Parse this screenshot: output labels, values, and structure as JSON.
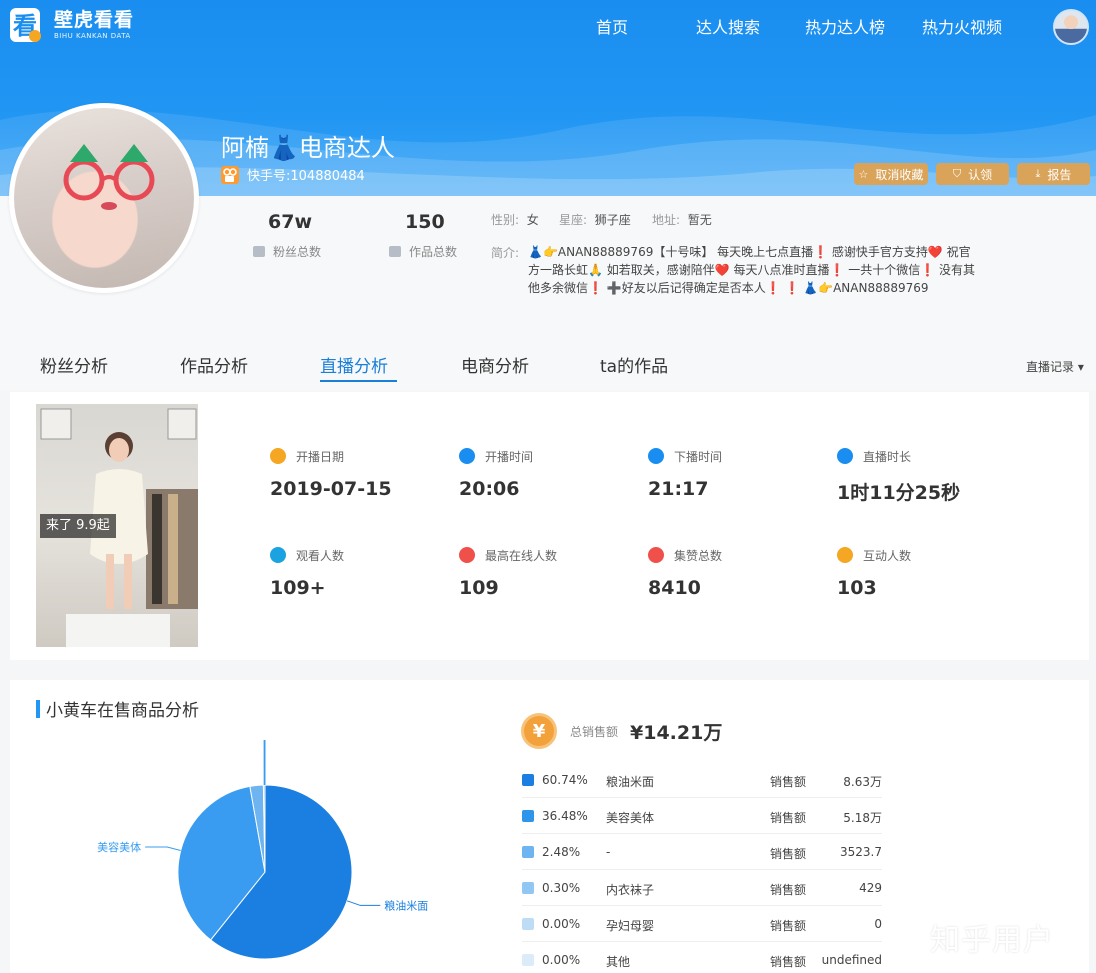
{
  "brand": {
    "title": "壁虎看看",
    "subtitle": "BIHU KANKAN DATA"
  },
  "nav": [
    {
      "label": "首页"
    },
    {
      "label": "达人搜索"
    },
    {
      "label": "热力达人榜"
    },
    {
      "label": "热力火视频"
    }
  ],
  "profile": {
    "name": "阿楠👗电商达人",
    "kuaishou_id": "快手号:104880484",
    "actions": {
      "unfollow": "取消收藏",
      "claim": "认领",
      "report": "报告"
    },
    "fans": {
      "value": "67w",
      "label": "粉丝总数"
    },
    "works": {
      "value": "150",
      "label": "作品总数"
    },
    "gender": {
      "label": "性别:",
      "value": "女"
    },
    "zodiac": {
      "label": "星座:",
      "value": "狮子座"
    },
    "location": {
      "label": "地址:",
      "value": "暂无"
    },
    "bio_label": "简介:",
    "bio": "👗👉ANAN88889769【十号味】 每天晚上七点直播❗ 感谢快手官方支持❤️ 祝官方一路长虹🙏 如若取关，感谢陪伴❤️ 每天八点准时直播❗ 一共十个微信❗ 没有其他多余微信❗ ➕好友以后记得确定是否本人❗ ❗ 👗👉ANAN88889769"
  },
  "tabs": [
    {
      "label": "粉丝分析"
    },
    {
      "label": "作品分析"
    },
    {
      "label": "直播分析",
      "active": true
    },
    {
      "label": "电商分析"
    },
    {
      "label": "ta的作品"
    }
  ],
  "live_record_dropdown": "直播记录 ▾",
  "live": {
    "cover_tag": "来了 9.9起",
    "kpis": [
      {
        "label": "开播日期",
        "value": "2019-07-15",
        "icon": "calendar-icon",
        "color": "#f5a623"
      },
      {
        "label": "开播时间",
        "value": "20:06",
        "icon": "play-icon",
        "color": "#1a8ef0"
      },
      {
        "label": "下播时间",
        "value": "21:17",
        "icon": "stop-icon",
        "color": "#1a8ef0"
      },
      {
        "label": "直播时长",
        "value": "1时11分25秒",
        "icon": "duration-icon",
        "color": "#1a8ef0"
      },
      {
        "label": "观看人数",
        "value": "109+",
        "icon": "eye-icon",
        "color": "#1aa3e0"
      },
      {
        "label": "最高在线人数",
        "value": "109",
        "icon": "peak-icon",
        "color": "#f0504a"
      },
      {
        "label": "集赞总数",
        "value": "8410",
        "icon": "heart-icon",
        "color": "#f0504a"
      },
      {
        "label": "互动人数",
        "value": "103",
        "icon": "chat-icon",
        "color": "#f5a623"
      }
    ]
  },
  "products": {
    "title": "小黄车在售商品分析",
    "total_label": "总销售额",
    "total_value": "¥14.21万",
    "coin_symbol": "¥",
    "rows": [
      {
        "pct": "60.74%",
        "name": "粮油米面",
        "metric": "销售额",
        "amount": "8.63万",
        "color": "#1a7fe0"
      },
      {
        "pct": "36.48%",
        "name": "美容美体",
        "metric": "销售额",
        "amount": "5.18万",
        "color": "#2d96ec"
      },
      {
        "pct": "2.48%",
        "name": "-",
        "metric": "销售额",
        "amount": "3523.7",
        "color": "#6db4f0"
      },
      {
        "pct": "0.30%",
        "name": "内衣袜子",
        "metric": "销售额",
        "amount": "429",
        "color": "#93c7f3"
      },
      {
        "pct": "0.00%",
        "name": "孕妇母婴",
        "metric": "销售额",
        "amount": "0",
        "color": "#bfdcf6"
      },
      {
        "pct": "0.00%",
        "name": "其他",
        "metric": "销售额",
        "amount": "undefined",
        "color": "#dcebf9"
      }
    ]
  },
  "chart_data": {
    "type": "pie",
    "categories": [
      "粮油米面",
      "美容美体",
      "-",
      "内衣袜子",
      "孕妇母婴"
    ],
    "values": [
      60.74,
      36.48,
      2.48,
      0.3,
      0.0
    ],
    "labels_shown": [
      "粮油米面",
      "美容美体",
      "内衣袜子",
      "孕妇母婴"
    ],
    "colors": [
      "#1a7fe0",
      "#3a9cf0",
      "#6db4f0",
      "#93c7f3",
      "#bfdcf6"
    ],
    "legend": "none"
  },
  "watermark": "知乎用户"
}
